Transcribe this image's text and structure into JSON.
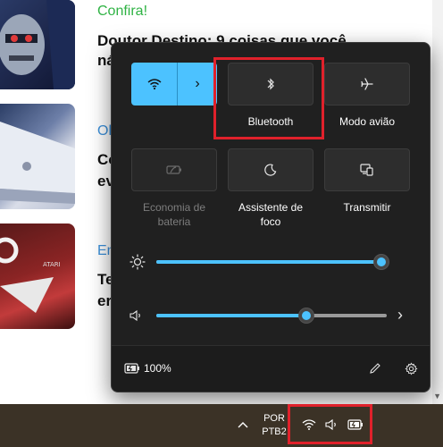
{
  "background_page": {
    "articles": [
      {
        "tag": "Confira!",
        "title_line1": "Doutor Destino: 9 coisas que você",
        "title_line2": "ná"
      },
      {
        "tag": "Ol",
        "title_line1": "Co",
        "title_line2": "ev"
      },
      {
        "tag": "Em",
        "title_line1": "Te",
        "title_line2": "er"
      }
    ],
    "tag_colors": {
      "first": "#2fb344",
      "others": "#3b8fd9"
    }
  },
  "quick_settings": {
    "tiles": [
      {
        "id": "wifi",
        "label": "",
        "active": true,
        "icon": "wifi-icon"
      },
      {
        "id": "bluetooth",
        "label": "Bluetooth",
        "active": false,
        "icon": "bluetooth-icon"
      },
      {
        "id": "airplane",
        "label": "Modo avião",
        "active": false,
        "icon": "airplane-icon"
      },
      {
        "id": "battery_saver",
        "label_line1": "Economia de",
        "label_line2": "bateria",
        "disabled": true,
        "icon": "battery-saver-icon"
      },
      {
        "id": "focus",
        "label_line1": "Assistente de",
        "label_line2": "foco",
        "active": false,
        "icon": "moon-icon"
      },
      {
        "id": "cast",
        "label": "Transmitir",
        "active": false,
        "icon": "cast-icon"
      }
    ],
    "brightness": {
      "icon": "sun-icon",
      "level": 1.0
    },
    "volume": {
      "icon": "speaker-icon",
      "level": 0.65
    },
    "battery": {
      "text": "100%",
      "icon": "battery-charging-icon"
    },
    "accent_color": "#4cc2ff"
  },
  "taskbar": {
    "lang_line1": "POR",
    "lang_line2": "PTB2",
    "tray_icons": [
      "wifi-icon",
      "speaker-icon",
      "battery-charging-icon"
    ]
  },
  "highlight_color": "#e0212b"
}
